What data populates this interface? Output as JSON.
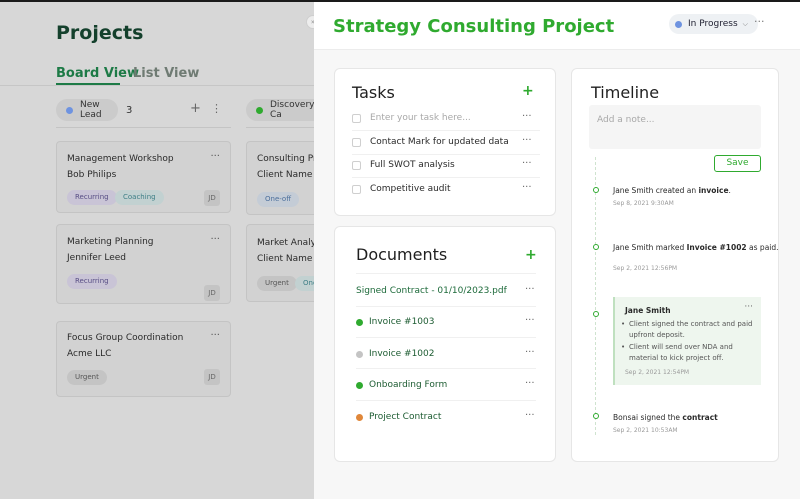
{
  "board": {
    "title": "Projects",
    "views": [
      "Board View",
      "List View"
    ],
    "columns": [
      {
        "label": "New Lead",
        "count": "3",
        "color": "#6e93e0"
      },
      {
        "label": "Discovery Ca",
        "color": "#2faa2f"
      }
    ],
    "cards_col1": [
      {
        "title": "Management Workshop",
        "client": "Bob Philips",
        "tags": [
          "Recurring",
          "Coaching"
        ],
        "avatar": "JD"
      },
      {
        "title": "Marketing Planning",
        "client": "Jennifer Leed",
        "tags": [
          "Recurring"
        ],
        "avatar": "JD"
      },
      {
        "title": "Focus Group Coordination",
        "client": "Acme LLC",
        "tags": [
          "Urgent"
        ],
        "avatar": "JD"
      }
    ],
    "cards_col2": [
      {
        "title": "Consulting Proj",
        "client": "Client Name",
        "tags": [
          "One-off"
        ]
      },
      {
        "title": "Market Analysis",
        "client": "Client Name",
        "tags": [
          "Urgent",
          "One"
        ]
      }
    ]
  },
  "panel": {
    "title": "Strategy Consulting Project",
    "status": "In Progress",
    "tasks": {
      "title": "Tasks",
      "placeholder": "Enter your task here...",
      "items": [
        "Contact Mark for updated data",
        "Full SWOT analysis",
        "Competitive audit"
      ]
    },
    "documents": {
      "title": "Documents",
      "items": [
        {
          "label": "Signed Contract - 01/10/2023.pdf",
          "dot": ""
        },
        {
          "label": "Invoice #1003",
          "dot": "#2faa2f"
        },
        {
          "label": "Invoice #1002",
          "dot": "#c4c4c4"
        },
        {
          "label": "Onboarding Form",
          "dot": "#2faa2f"
        },
        {
          "label": "Project Contract",
          "dot": "#e0873a"
        }
      ]
    },
    "timeline": {
      "title": "Timeline",
      "note_placeholder": "Add a note...",
      "save_label": "Save",
      "events": [
        {
          "prefix": "Jane Smith created an ",
          "bold": "invoice",
          "suffix": ".",
          "date": "Sep 8, 2021 9:30AM"
        },
        {
          "prefix": "Jane Smith marked ",
          "bold": "Invoice #1002",
          "suffix": " as paid.",
          "date": "Sep 2, 2021 12:56PM"
        },
        {
          "prefix": "Bonsai signed the ",
          "bold": "contract",
          "suffix": "",
          "date": "Sep 2, 2021 10:53AM"
        }
      ],
      "note": {
        "author": "Jane Smith",
        "bullets": [
          "Client signed the contract and paid upfront deposit.",
          "Client will send over NDA and material to kick project off."
        ],
        "date": "Sep 2, 2021 12:54PM"
      }
    }
  },
  "colors": {
    "accent": "#2faa2f",
    "dark_green": "#14402c",
    "status_dot": "#6e93e0"
  }
}
